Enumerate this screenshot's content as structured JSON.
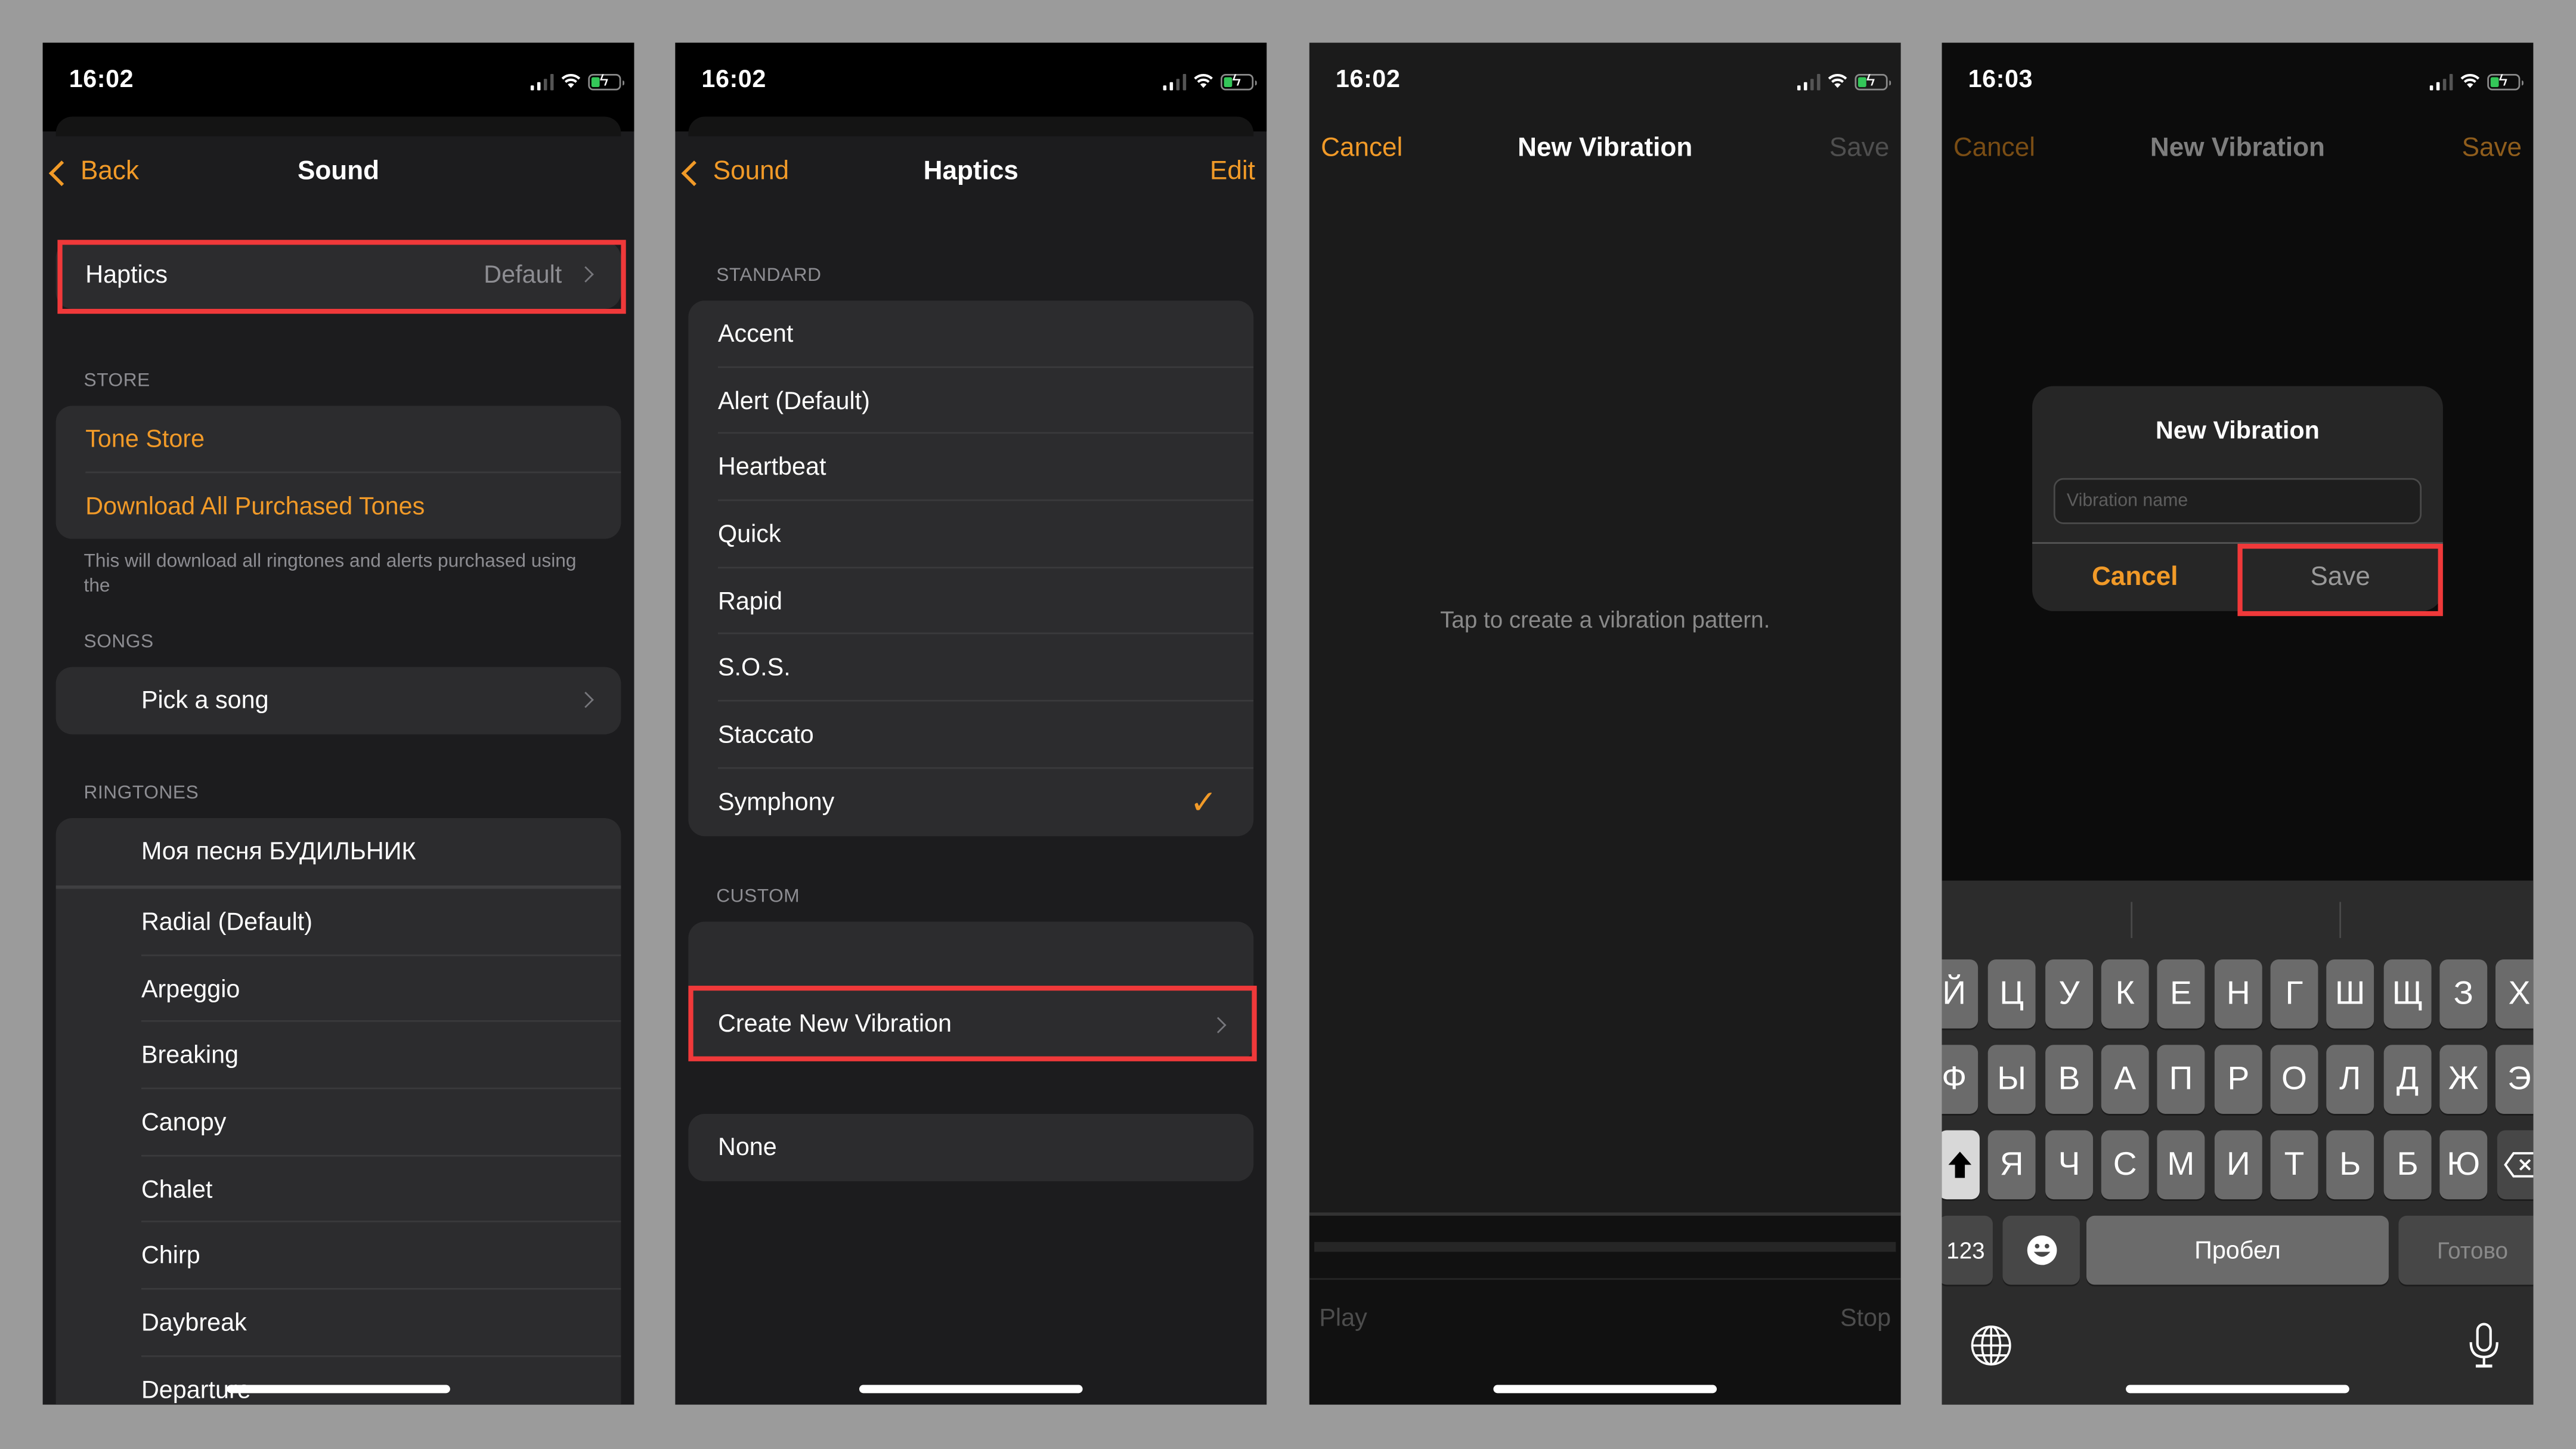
{
  "colors": {
    "accent": "#f19a28",
    "highlight": "#f0393a",
    "battery_fill": "#34c759",
    "background": "#9b9b9b"
  },
  "panels": [
    {
      "status": {
        "time": "16:02"
      },
      "nav": {
        "back_label": "Back",
        "title": "Sound"
      },
      "haptics_row": {
        "label": "Haptics",
        "value": "Default"
      },
      "store": {
        "header": "STORE",
        "items": [
          "Tone Store",
          "Download All Purchased Tones"
        ],
        "note": "This will download all ringtones and alerts purchased using the"
      },
      "songs": {
        "header": "SONGS",
        "items": [
          "Pick a song"
        ]
      },
      "ringtones": {
        "header": "RINGTONES",
        "items": [
          "Моя песня БУДИЛЬНИК",
          "Radial (Default)",
          "Arpeggio",
          "Breaking",
          "Canopy",
          "Chalet",
          "Chirp",
          "Daybreak",
          "Departure"
        ]
      }
    },
    {
      "status": {
        "time": "16:02"
      },
      "nav": {
        "back_label": "Sound",
        "title": "Haptics",
        "right_label": "Edit"
      },
      "standard": {
        "header": "STANDARD",
        "items": [
          "Accent",
          "Alert (Default)",
          "Heartbeat",
          "Quick",
          "Rapid",
          "S.O.S.",
          "Staccato",
          "Symphony"
        ],
        "selected": "Symphony"
      },
      "custom": {
        "header": "CUSTOM",
        "items": [
          "",
          "Create New Vibration"
        ]
      },
      "none_label": "None"
    },
    {
      "status": {
        "time": "16:02"
      },
      "nav": {
        "left_label": "Cancel",
        "title": "New Vibration",
        "right_label": "Save"
      },
      "hint": "Tap to create a vibration pattern.",
      "play_label": "Play",
      "stop_label": "Stop"
    },
    {
      "status": {
        "time": "16:03"
      },
      "nav": {
        "left_label": "Cancel",
        "title": "New Vibration",
        "right_label": "Save"
      },
      "dialog": {
        "title": "New Vibration",
        "input_placeholder": "Vibration name",
        "input_value": "",
        "cancel_label": "Cancel",
        "save_label": "Save"
      },
      "keyboard": {
        "row1": [
          "Й",
          "Ц",
          "У",
          "К",
          "Е",
          "Н",
          "Г",
          "Ш",
          "Щ",
          "З",
          "Х"
        ],
        "row2": [
          "Ф",
          "Ы",
          "В",
          "А",
          "П",
          "Р",
          "О",
          "Л",
          "Д",
          "Ж",
          "Э"
        ],
        "row3": [
          "Я",
          "Ч",
          "С",
          "М",
          "И",
          "Т",
          "Ь",
          "Б",
          "Ю"
        ],
        "numbers_label": "123",
        "space_label": "Пробел",
        "done_label": "Готово"
      }
    }
  ]
}
